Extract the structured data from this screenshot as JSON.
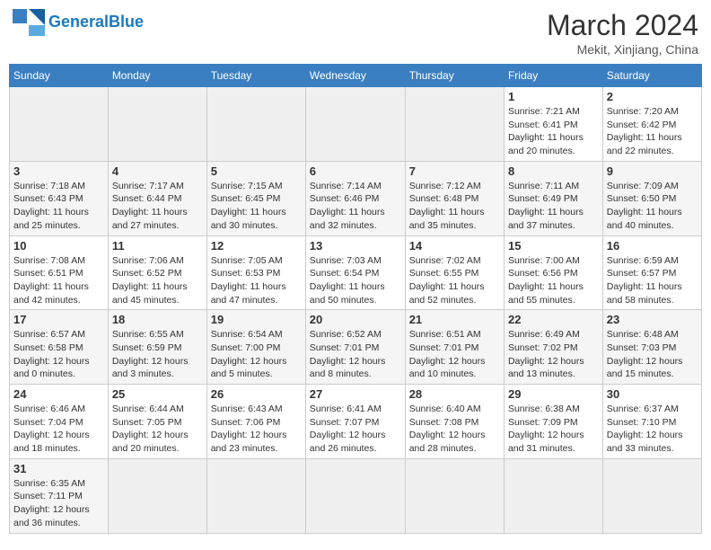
{
  "header": {
    "logo_general": "General",
    "logo_blue": "Blue",
    "month_year": "March 2024",
    "location": "Mekit, Xinjiang, China"
  },
  "days_of_week": [
    "Sunday",
    "Monday",
    "Tuesday",
    "Wednesday",
    "Thursday",
    "Friday",
    "Saturday"
  ],
  "weeks": [
    [
      {
        "day": "",
        "info": ""
      },
      {
        "day": "",
        "info": ""
      },
      {
        "day": "",
        "info": ""
      },
      {
        "day": "",
        "info": ""
      },
      {
        "day": "",
        "info": ""
      },
      {
        "day": "1",
        "info": "Sunrise: 7:21 AM\nSunset: 6:41 PM\nDaylight: 11 hours and 20 minutes."
      },
      {
        "day": "2",
        "info": "Sunrise: 7:20 AM\nSunset: 6:42 PM\nDaylight: 11 hours and 22 minutes."
      }
    ],
    [
      {
        "day": "3",
        "info": "Sunrise: 7:18 AM\nSunset: 6:43 PM\nDaylight: 11 hours and 25 minutes."
      },
      {
        "day": "4",
        "info": "Sunrise: 7:17 AM\nSunset: 6:44 PM\nDaylight: 11 hours and 27 minutes."
      },
      {
        "day": "5",
        "info": "Sunrise: 7:15 AM\nSunset: 6:45 PM\nDaylight: 11 hours and 30 minutes."
      },
      {
        "day": "6",
        "info": "Sunrise: 7:14 AM\nSunset: 6:46 PM\nDaylight: 11 hours and 32 minutes."
      },
      {
        "day": "7",
        "info": "Sunrise: 7:12 AM\nSunset: 6:48 PM\nDaylight: 11 hours and 35 minutes."
      },
      {
        "day": "8",
        "info": "Sunrise: 7:11 AM\nSunset: 6:49 PM\nDaylight: 11 hours and 37 minutes."
      },
      {
        "day": "9",
        "info": "Sunrise: 7:09 AM\nSunset: 6:50 PM\nDaylight: 11 hours and 40 minutes."
      }
    ],
    [
      {
        "day": "10",
        "info": "Sunrise: 7:08 AM\nSunset: 6:51 PM\nDaylight: 11 hours and 42 minutes."
      },
      {
        "day": "11",
        "info": "Sunrise: 7:06 AM\nSunset: 6:52 PM\nDaylight: 11 hours and 45 minutes."
      },
      {
        "day": "12",
        "info": "Sunrise: 7:05 AM\nSunset: 6:53 PM\nDaylight: 11 hours and 47 minutes."
      },
      {
        "day": "13",
        "info": "Sunrise: 7:03 AM\nSunset: 6:54 PM\nDaylight: 11 hours and 50 minutes."
      },
      {
        "day": "14",
        "info": "Sunrise: 7:02 AM\nSunset: 6:55 PM\nDaylight: 11 hours and 52 minutes."
      },
      {
        "day": "15",
        "info": "Sunrise: 7:00 AM\nSunset: 6:56 PM\nDaylight: 11 hours and 55 minutes."
      },
      {
        "day": "16",
        "info": "Sunrise: 6:59 AM\nSunset: 6:57 PM\nDaylight: 11 hours and 58 minutes."
      }
    ],
    [
      {
        "day": "17",
        "info": "Sunrise: 6:57 AM\nSunset: 6:58 PM\nDaylight: 12 hours and 0 minutes."
      },
      {
        "day": "18",
        "info": "Sunrise: 6:55 AM\nSunset: 6:59 PM\nDaylight: 12 hours and 3 minutes."
      },
      {
        "day": "19",
        "info": "Sunrise: 6:54 AM\nSunset: 7:00 PM\nDaylight: 12 hours and 5 minutes."
      },
      {
        "day": "20",
        "info": "Sunrise: 6:52 AM\nSunset: 7:01 PM\nDaylight: 12 hours and 8 minutes."
      },
      {
        "day": "21",
        "info": "Sunrise: 6:51 AM\nSunset: 7:01 PM\nDaylight: 12 hours and 10 minutes."
      },
      {
        "day": "22",
        "info": "Sunrise: 6:49 AM\nSunset: 7:02 PM\nDaylight: 12 hours and 13 minutes."
      },
      {
        "day": "23",
        "info": "Sunrise: 6:48 AM\nSunset: 7:03 PM\nDaylight: 12 hours and 15 minutes."
      }
    ],
    [
      {
        "day": "24",
        "info": "Sunrise: 6:46 AM\nSunset: 7:04 PM\nDaylight: 12 hours and 18 minutes."
      },
      {
        "day": "25",
        "info": "Sunrise: 6:44 AM\nSunset: 7:05 PM\nDaylight: 12 hours and 20 minutes."
      },
      {
        "day": "26",
        "info": "Sunrise: 6:43 AM\nSunset: 7:06 PM\nDaylight: 12 hours and 23 minutes."
      },
      {
        "day": "27",
        "info": "Sunrise: 6:41 AM\nSunset: 7:07 PM\nDaylight: 12 hours and 26 minutes."
      },
      {
        "day": "28",
        "info": "Sunrise: 6:40 AM\nSunset: 7:08 PM\nDaylight: 12 hours and 28 minutes."
      },
      {
        "day": "29",
        "info": "Sunrise: 6:38 AM\nSunset: 7:09 PM\nDaylight: 12 hours and 31 minutes."
      },
      {
        "day": "30",
        "info": "Sunrise: 6:37 AM\nSunset: 7:10 PM\nDaylight: 12 hours and 33 minutes."
      }
    ],
    [
      {
        "day": "31",
        "info": "Sunrise: 6:35 AM\nSunset: 7:11 PM\nDaylight: 12 hours and 36 minutes."
      },
      {
        "day": "",
        "info": ""
      },
      {
        "day": "",
        "info": ""
      },
      {
        "day": "",
        "info": ""
      },
      {
        "day": "",
        "info": ""
      },
      {
        "day": "",
        "info": ""
      },
      {
        "day": "",
        "info": ""
      }
    ]
  ]
}
